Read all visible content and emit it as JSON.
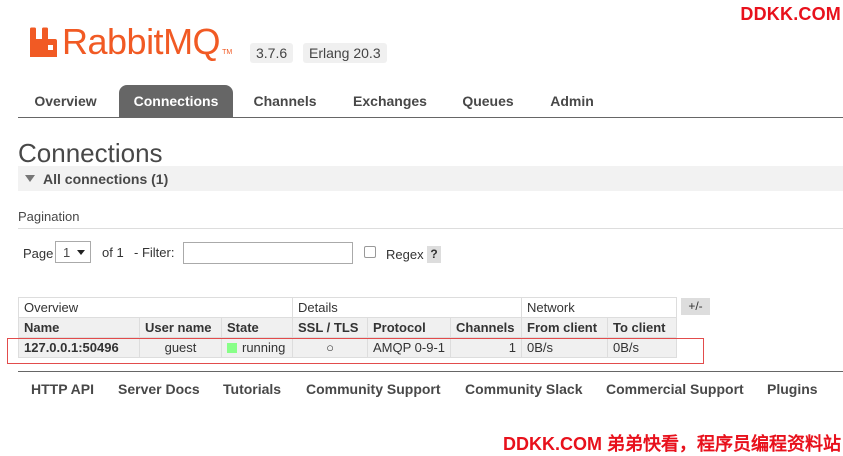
{
  "watermark": {
    "top": "DDKK.COM",
    "bottom": "DDKK.COM 弟弟快看，程序员编程资料站"
  },
  "brand": {
    "name": "RabbitMQ",
    "tm": "TM",
    "version": "3.7.6",
    "erlang": "Erlang 20.3",
    "color": "#f15a24"
  },
  "nav": {
    "tabs": [
      {
        "label": "Overview",
        "active": false
      },
      {
        "label": "Connections",
        "active": true
      },
      {
        "label": "Channels",
        "active": false
      },
      {
        "label": "Exchanges",
        "active": false
      },
      {
        "label": "Queues",
        "active": false
      },
      {
        "label": "Admin",
        "active": false
      }
    ]
  },
  "page": {
    "title": "Connections",
    "section": "All connections (1)"
  },
  "pagination": {
    "label": "Pagination",
    "page_label": "Page",
    "page_value": "1",
    "of_label": "of 1",
    "filter_label": "- Filter:",
    "filter_value": "",
    "regex_label": "Regex",
    "help": "?"
  },
  "table": {
    "groups": [
      "Overview",
      "Details",
      "Network"
    ],
    "columns": [
      "Name",
      "User name",
      "State",
      "SSL / TLS",
      "Protocol",
      "Channels",
      "From client",
      "To client"
    ],
    "plus_minus": "+/-",
    "rows": [
      {
        "name": "127.0.0.1:50496",
        "user": "guest",
        "state": "running",
        "ssl": "○",
        "protocol": "AMQP 0-9-1",
        "channels": "1",
        "from_client": "0B/s",
        "to_client": "0B/s"
      }
    ],
    "state_color": "#88ff88"
  },
  "footer": {
    "links": [
      "HTTP API",
      "Server Docs",
      "Tutorials",
      "Community Support",
      "Community Slack",
      "Commercial Support",
      "Plugins"
    ]
  }
}
